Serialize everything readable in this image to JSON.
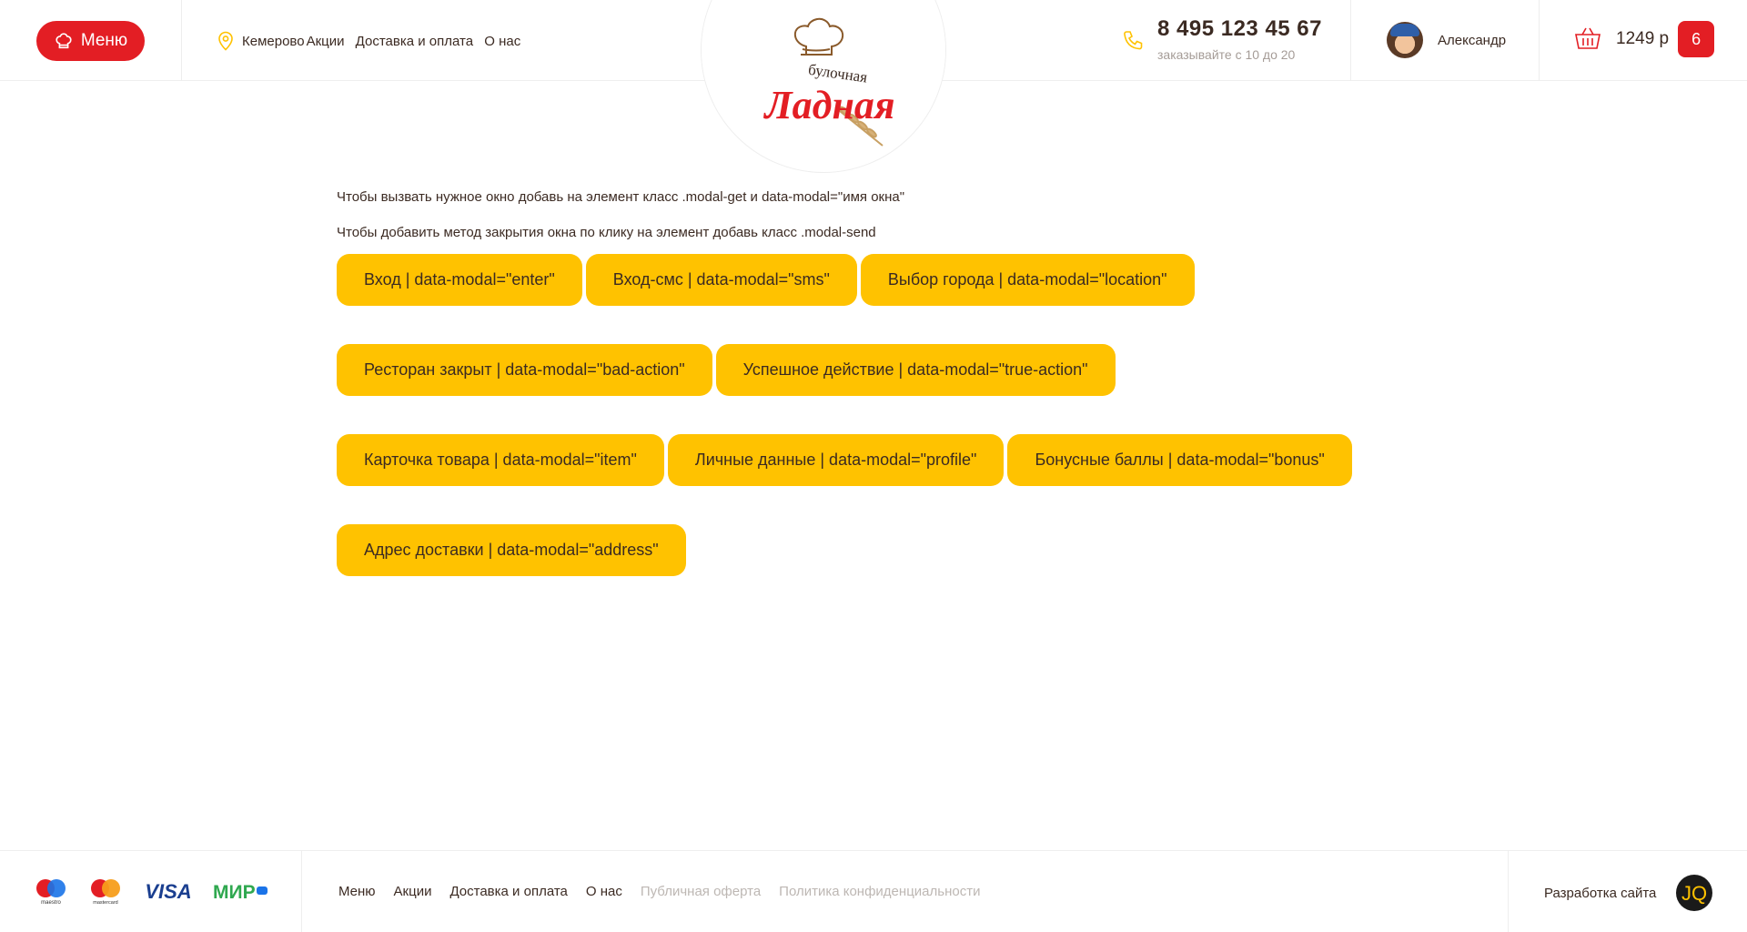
{
  "header": {
    "menu_label": "Меню",
    "city": "Кемерово",
    "nav": [
      "Акции",
      "Доставка и оплата",
      "О нас"
    ],
    "logo": {
      "top_text": "булочная",
      "main_text": "Ладная"
    },
    "phone": "8 495 123 45 67",
    "hours": "заказывайте с 10 до 20",
    "user_name": "Александр",
    "cart_sum": "1249 р",
    "cart_count": "6"
  },
  "main": {
    "hint1": "Чтобы вызвать нужное окно добавь на элемент класс .modal-get и data-modal=\"имя окна\"",
    "hint2": "Чтобы добавить метод закрытия окна по клику на элемент добавь класс .modal-send",
    "buttons": [
      "Вход | data-modal=\"enter\"",
      "Вход-смс | data-modal=\"sms\"",
      "Выбор города | data-modal=\"location\"",
      "Ресторан закрыт | data-modal=\"bad-action\"",
      "Успешное действие | data-modal=\"true-action\"",
      "Карточка товара | data-modal=\"item\"",
      "Личные данные | data-modal=\"profile\"",
      "Бонусные баллы | data-modal=\"bonus\"",
      "Адрес доставки | data-modal=\"address\""
    ]
  },
  "footer": {
    "payment_icons": [
      "maestro-icon",
      "mastercard-icon",
      "visa-icon",
      "mir-icon"
    ],
    "payment_labels": {
      "maestro": "maestro",
      "mastercard": "mastercard",
      "visa": "VISA",
      "mir": "МИР"
    },
    "nav": [
      "Меню",
      "Акции",
      "Доставка и оплата",
      "О нас"
    ],
    "muted_links": [
      "Публичная оферта",
      "Политика конфиденциальности"
    ],
    "dev_label": "Разработка сайта",
    "dev_logo": "JQ"
  },
  "colors": {
    "accent_red": "#e31e24",
    "button_yellow": "#ffc200",
    "text_brown": "#3b2a22",
    "muted_gray": "#bdb7b3"
  }
}
